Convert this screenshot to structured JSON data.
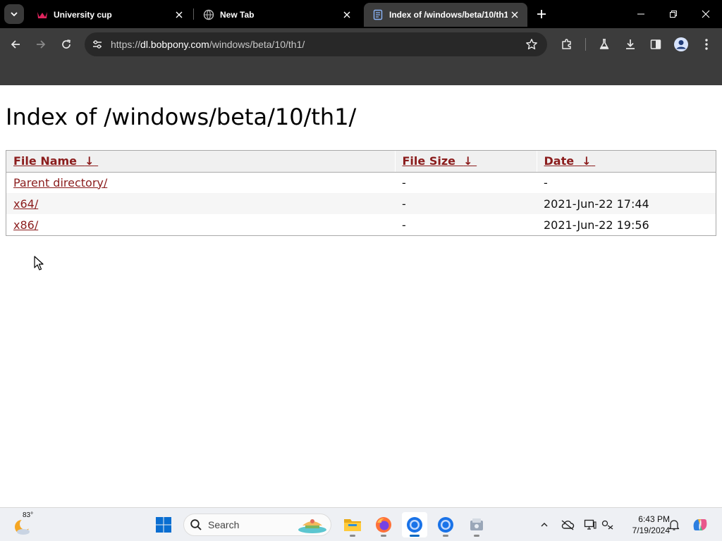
{
  "browser": {
    "tabs": [
      {
        "title": "University cup",
        "favicon": "crown-icon",
        "active": false
      },
      {
        "title": "New Tab",
        "favicon": "globe-icon",
        "active": false
      },
      {
        "title": "Index of /windows/beta/10/th1/",
        "favicon": "page-icon",
        "active": true
      }
    ],
    "url_scheme": "https://",
    "url_host": "dl.bobpony.com",
    "url_path": "/windows/beta/10/th1/"
  },
  "page": {
    "heading": "Index of /windows/beta/10/th1/",
    "columns": [
      {
        "label": "File Name",
        "sort": "↓"
      },
      {
        "label": "File Size",
        "sort": "↓"
      },
      {
        "label": "Date",
        "sort": "↓"
      }
    ],
    "rows": [
      {
        "name": "Parent directory/",
        "size": "-",
        "date": "-"
      },
      {
        "name": "x64/",
        "size": "-",
        "date": "2021-Jun-22 17:44"
      },
      {
        "name": "x86/",
        "size": "-",
        "date": "2021-Jun-22 19:56"
      }
    ]
  },
  "taskbar": {
    "weather_temp": "83°",
    "search_placeholder": "Search",
    "time": "6:43 PM",
    "date": "7/19/2024"
  },
  "colors": {
    "link": "#8b1d1d",
    "tab_active": "#3c3c3c",
    "taskbar_accent": "#0067c0"
  }
}
